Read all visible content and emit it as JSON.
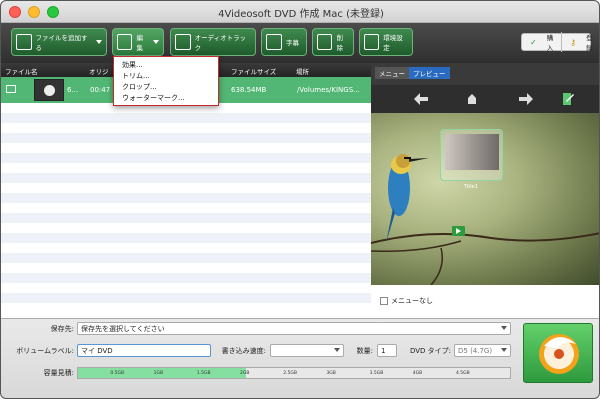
{
  "window": {
    "title": "4Videosoft DVD 作成 Mac (未登録)"
  },
  "toolbar": {
    "add_file_label": "ファイルを追加する",
    "edit_label": "編集",
    "audio_track_label": "オーディオトラック",
    "subtitle_label": "字幕",
    "delete_label": "削除",
    "settings_label": "環境設定",
    "buy_label": "購入",
    "register_label": "登録"
  },
  "edit_menu": {
    "items": [
      {
        "label": "効果..."
      },
      {
        "label": "トリム..."
      },
      {
        "label": "クロップ..."
      },
      {
        "label": "ウォーターマーク..."
      }
    ]
  },
  "table": {
    "columns": [
      "ファイル名",
      "オリジ",
      "ファイルサイズ",
      "場所"
    ],
    "rows": [
      {
        "name": "6...",
        "duration": "00:47",
        "size": "638.54MB",
        "location": "/Volumes/KINGS..."
      }
    ]
  },
  "preview": {
    "tab_menu": "メニュー",
    "tab_preview": "プレビュー",
    "title_caption": "Title1",
    "no_menu_label": "メニューなし"
  },
  "bottom": {
    "destination_label": "保存先:",
    "destination_value": "保存先を選択してください",
    "volume_label": "ボリュームラベル:",
    "volume_value": "マイ DVD",
    "write_speed_label": "書き込み速度:",
    "write_speed_value": "",
    "copies_label": "数量:",
    "copies_value": "1",
    "dvd_type_label": "DVD タイプ:",
    "dvd_type_value": "D5 (4.7G)",
    "capacity_label": "容量見積:",
    "capacity_ticks": [
      "0.5GB",
      "1GB",
      "1.5GB",
      "2GB",
      "2.5GB",
      "3GB",
      "3.5GB",
      "4GB",
      "4.5GB"
    ],
    "capacity_used_fraction": 0.39
  },
  "colors": {
    "accent_green": "#52b774",
    "menu_border": "#c62a2a",
    "tab_active": "#2a6bc2"
  }
}
